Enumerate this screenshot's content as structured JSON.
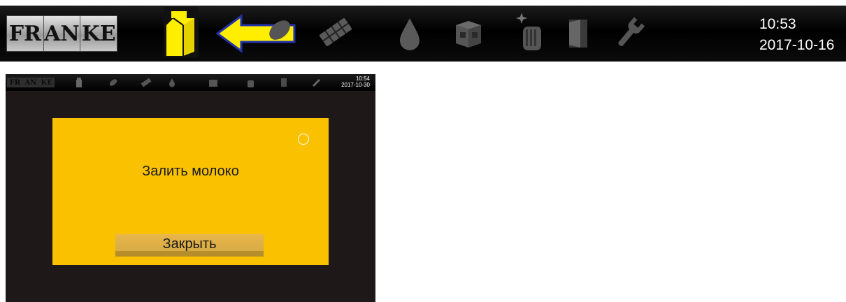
{
  "top_bar": {
    "logo_letters": [
      "FR",
      "AN",
      "KE"
    ],
    "time": "10:53",
    "date": "2017-10-16",
    "highlight_color": "#ffee00",
    "icons": [
      "milk-carton-icon",
      "coffee-bean-icon",
      "chocolate-tablet-icon",
      "water-drop-icon",
      "cup-box-icon",
      "cleaning-hand-icon",
      "door-icon",
      "wrench-icon"
    ]
  },
  "screen": {
    "logo_letters": [
      "FR",
      "AN",
      "KE"
    ],
    "time": "10:54",
    "date": "2017-10-30",
    "dialog": {
      "message": "Залить молоко",
      "close_label": "Закрыть",
      "background": "#f9c100"
    }
  }
}
